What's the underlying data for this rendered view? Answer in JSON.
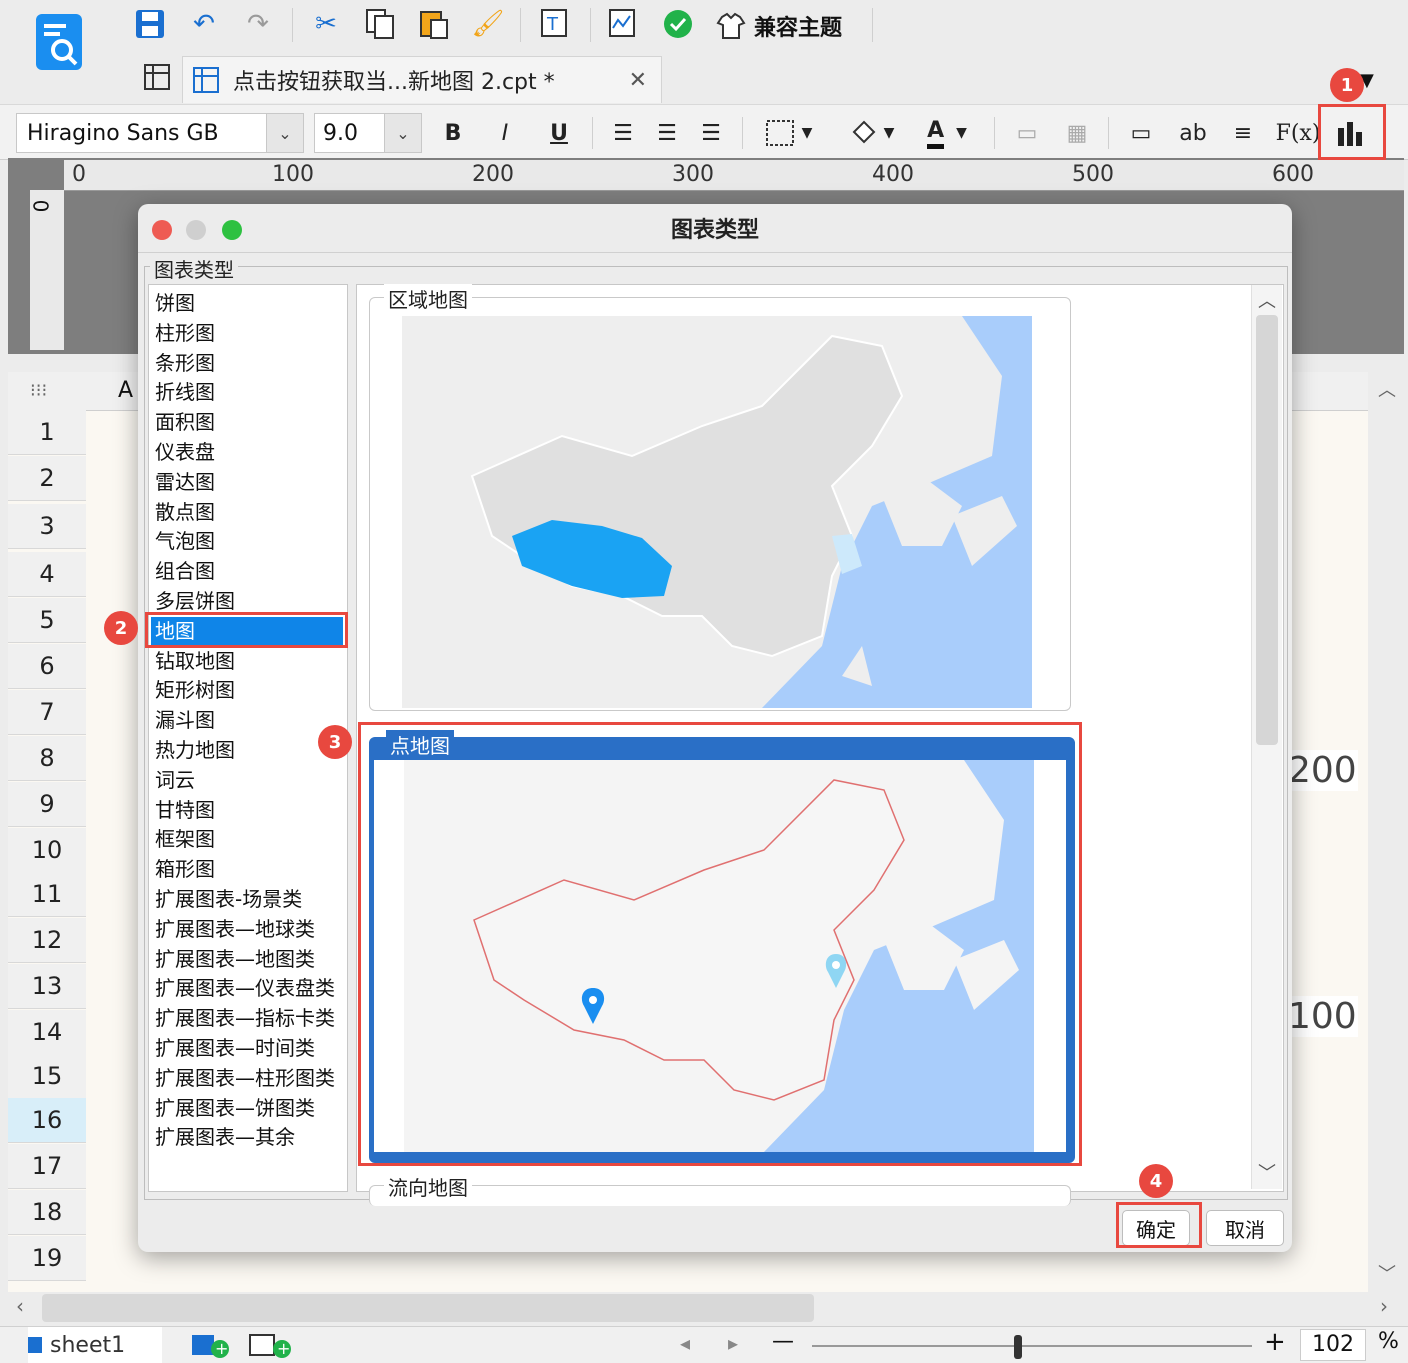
{
  "toolbar": {
    "theme_label": "兼容主题",
    "tab_title": "点击按钮获取当...新地图 2.cpt *"
  },
  "format_bar": {
    "font_family": "Hiragino Sans GB",
    "font_size": "9.0",
    "bold_label": "B",
    "italic_label": "I",
    "underline_label": "U",
    "text_color_label": "A",
    "ab_label": "ab",
    "formula_label": "F(x)"
  },
  "ruler": {
    "h_ticks": [
      "0",
      "100",
      "200",
      "300",
      "400",
      "500",
      "600"
    ],
    "v_tick": "0"
  },
  "sheet": {
    "column_a": "A",
    "rows": [
      "1",
      "2",
      "3",
      "4",
      "5",
      "6",
      "7",
      "8",
      "9",
      "10",
      "11",
      "12",
      "13",
      "14",
      "15",
      "16",
      "17",
      "18",
      "19"
    ],
    "background_values": [
      "200",
      "100"
    ],
    "selected_row": "16"
  },
  "status": {
    "sheet_tab": "sheet1",
    "zoom_value": "102",
    "zoom_unit": "%",
    "zoom_minus": "—",
    "zoom_plus": "+"
  },
  "dialog": {
    "title": "图表类型",
    "group_label": "图表类型",
    "chart_types": [
      "饼图",
      "柱形图",
      "条形图",
      "折线图",
      "面积图",
      "仪表盘",
      "雷达图",
      "散点图",
      "气泡图",
      "组合图",
      "多层饼图",
      "地图",
      "钻取地图",
      "矩形树图",
      "漏斗图",
      "热力地图",
      "词云",
      "甘特图",
      "框架图",
      "箱形图",
      "扩展图表-场景类",
      "扩展图表—地球类",
      "扩展图表—地图类",
      "扩展图表—仪表盘类",
      "扩展图表—指标卡类",
      "扩展图表—时间类",
      "扩展图表—柱形图类",
      "扩展图表—饼图类",
      "扩展图表—其余"
    ],
    "selected_type": "地图",
    "previews": {
      "region_map": "区域地图",
      "point_map": "点地图",
      "flow_map": "流向地图"
    },
    "ok_label": "确定",
    "cancel_label": "取消"
  },
  "annotations": [
    "1",
    "2",
    "3",
    "4"
  ],
  "colors": {
    "accent_red": "#e8483f",
    "select_blue": "#0f85e8",
    "map_sea": "#a9cdfb",
    "map_land": "#e3e3e3",
    "map_highlight": "#1aa3f3",
    "selected_card": "#2a6fc6"
  }
}
